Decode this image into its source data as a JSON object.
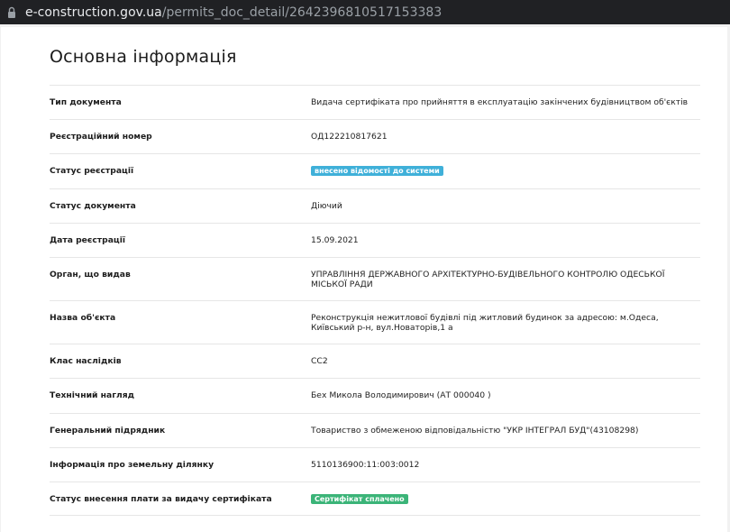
{
  "browser": {
    "url_domain": "e-construction.gov.ua",
    "url_path": "/permits_doc_detail/2642396810517153383"
  },
  "page": {
    "title": "Основна інформація"
  },
  "rows": [
    {
      "label": "Тип документа",
      "value": "Видача сертифіката про прийняття в експлуатацію закінчених будівництвом об'єктів"
    },
    {
      "label": "Реєстраційний номер",
      "value": "ОД122210817621"
    },
    {
      "label": "Статус реєстрації",
      "badge": "внесено відомості до системи",
      "badge_color": "#3fb0d9"
    },
    {
      "label": "Статус документа",
      "value": "Діючий"
    },
    {
      "label": "Дата реєстрації",
      "value": "15.09.2021"
    },
    {
      "label": "Орган, що видав",
      "value": "УПРАВЛІННЯ ДЕРЖАВНОГО АРХІТЕКТУРНО-БУДІВЕЛЬНОГО КОНТРОЛЮ ОДЕСЬКОЇ МІСЬКОЇ РАДИ"
    },
    {
      "label": "Назва об'єкта",
      "value": "Реконструкція нежитлової будівлі під житловий будинок за адресою: м.Одеса, Київський р-н, вул.Новаторів,1 а"
    },
    {
      "label": "Клас наслідків",
      "value": "СС2"
    },
    {
      "label": "Технічний нагляд",
      "value": "Бех Микола Володимирович (АТ 000040 )"
    },
    {
      "label": "Генеральний підрядник",
      "value": "Товариство з обмеженою відповідальністю \"УКР ІНТЕГРАЛ БУД\"(43108298)"
    },
    {
      "label": "Інформація про земельну ділянку",
      "value": "5110136900:11:003:0012"
    },
    {
      "label": "Статус внесення плати за видачу сертифіката",
      "badge": "Сертифікат сплачено",
      "badge_color": "#3bb478"
    }
  ]
}
